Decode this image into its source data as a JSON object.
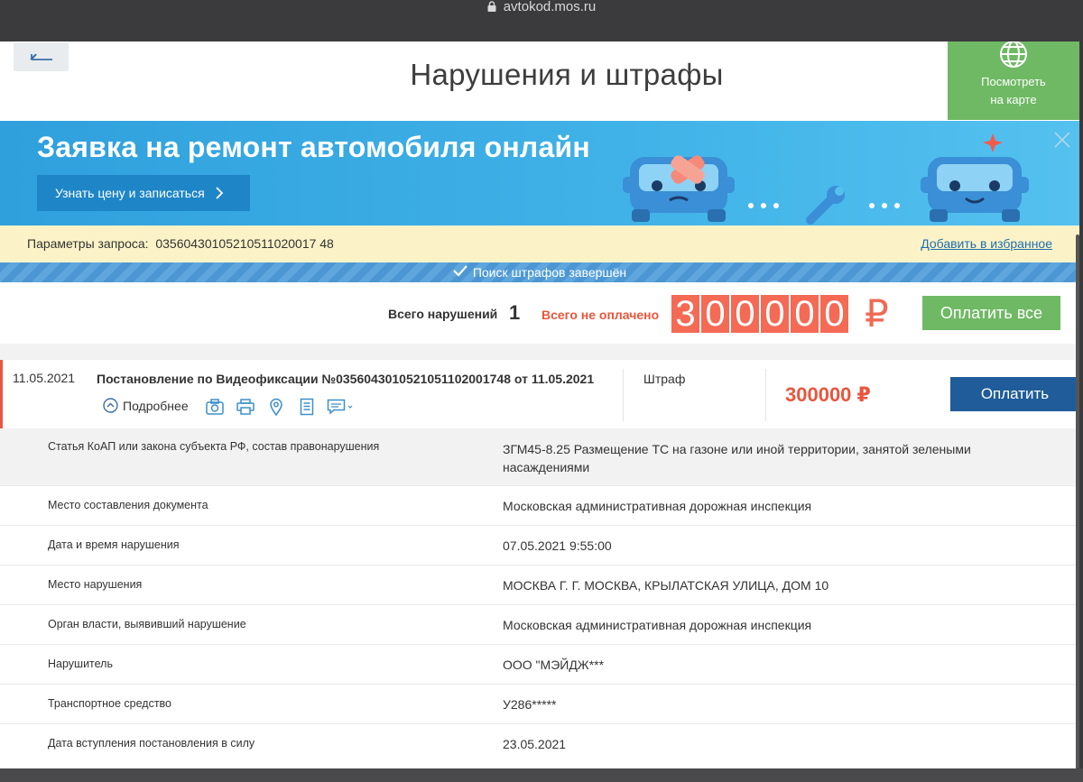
{
  "browser": {
    "url": "avtokod.mos.ru"
  },
  "header": {
    "back_icon": "back-arrow-icon",
    "title": "Нарушения и штрафы",
    "map_button": {
      "line1": "Посмотреть",
      "line2": "на карте",
      "icon": "globe-icon"
    }
  },
  "banner": {
    "title": "Заявка на ремонт автомобиля онлайн",
    "button_label": "Узнать цену и записаться",
    "colors": {
      "background": "#41b3e8",
      "button": "#1e86c7"
    }
  },
  "params": {
    "label": "Параметры запроса:",
    "value": "03560430105210511020017 48",
    "favorite_link": "Добавить в избранное"
  },
  "search_status": "Поиск штрафов завершён",
  "totals": {
    "violations_label": "Всего нарушений",
    "violations_count": "1",
    "unpaid_label": "Всего не оплачено",
    "unpaid_digits": [
      "3",
      "0",
      "0",
      "0",
      "0",
      "0"
    ],
    "currency": "₽",
    "pay_all_label": "Оплатить все"
  },
  "violation": {
    "date": "11.05.2021",
    "decree": "Постановление по Видеофиксации №0356043010521051102001748 от 11.05.2021",
    "more_label": "Подробнее",
    "type": "Штраф",
    "amount": "300000 ₽",
    "pay_label": "Оплатить",
    "action_icons": [
      "photo-icon",
      "print-icon",
      "map-pin-icon",
      "document-icon",
      "comment-icon"
    ]
  },
  "details": [
    {
      "key": "Статья КоАП или закона субъекта РФ, состав правонарушения",
      "value": "ЗГМ45-8.25 Размещение ТС на газоне или иной территории, занятой зелеными насаждениями"
    },
    {
      "key": "Место составления документа",
      "value": "Московская административная дорожная инспекция"
    },
    {
      "key": "Дата и время нарушения",
      "value": "07.05.2021 9:55:00"
    },
    {
      "key": "Место нарушения",
      "value": "МОСКВА Г. Г. МОСКВА, КРЫЛАТСКАЯ УЛИЦА, ДОМ 10"
    },
    {
      "key": "Орган власти, выявивший нарушение",
      "value": "Московская административная дорожная инспекция"
    },
    {
      "key": "Нарушитель",
      "value": "ООО \"МЭЙДЖ***"
    },
    {
      "key": "Транспортное средство",
      "value": "У286*****"
    },
    {
      "key": "Дата вступления постановления в силу",
      "value": "23.05.2021"
    }
  ]
}
